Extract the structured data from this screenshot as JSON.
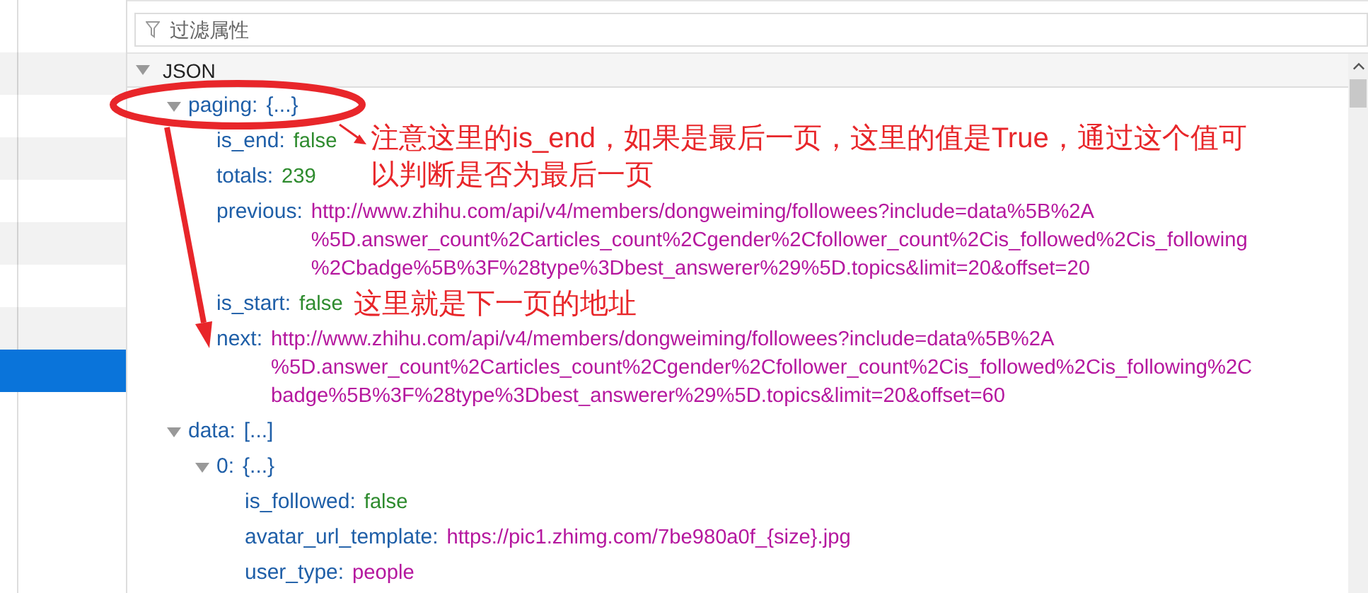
{
  "sidebar": {
    "rows": [
      {
        "selected": false
      },
      {
        "selected": false
      },
      {
        "selected": false
      },
      {
        "selected": false
      },
      {
        "selected": false
      },
      {
        "selected": false
      },
      {
        "selected": false
      },
      {
        "selected": false
      },
      {
        "selected": true
      }
    ]
  },
  "filter": {
    "placeholder": "过滤属性"
  },
  "tree": {
    "label": "JSON",
    "expanded": true,
    "children": [
      {
        "kind": "object",
        "key": "paging:",
        "summary": "{...}",
        "expanded": true,
        "children": [
          {
            "kind": "bool",
            "key": "is_end:",
            "lines": [
              "false"
            ]
          },
          {
            "kind": "number",
            "key": "totals:",
            "lines": [
              "239"
            ]
          },
          {
            "kind": "string",
            "key": "previous:",
            "lines": [
              "http://www.zhihu.com/api/v4/members/dongweiming/followees?include=data%5B%2A",
              "%5D.answer_count%2Carticles_count%2Cgender%2Cfollower_count%2Cis_followed%2Cis_following",
              "%2Cbadge%5B%3F%28type%3Dbest_answerer%29%5D.topics&limit=20&offset=20"
            ]
          },
          {
            "kind": "bool",
            "key": "is_start:",
            "lines": [
              "false"
            ]
          },
          {
            "kind": "string",
            "key": "next:",
            "lines": [
              "http://www.zhihu.com/api/v4/members/dongweiming/followees?include=data%5B%2A",
              "%5D.answer_count%2Carticles_count%2Cgender%2Cfollower_count%2Cis_followed%2Cis_following%2C",
              "badge%5B%3F%28type%3Dbest_answerer%29%5D.topics&limit=20&offset=60"
            ]
          }
        ]
      },
      {
        "kind": "object",
        "key": "data:",
        "summary": "[...]",
        "expanded": true,
        "children": [
          {
            "kind": "object",
            "key": "0:",
            "summary": "{...}",
            "expanded": true,
            "children": [
              {
                "kind": "bool",
                "key": "is_followed:",
                "lines": [
                  "false"
                ]
              },
              {
                "kind": "string",
                "key": "avatar_url_template:",
                "lines": [
                  "https://pic1.zhimg.com/7be980a0f_{size}.jpg"
                ]
              },
              {
                "kind": "string",
                "key": "user_type:",
                "lines": [
                  "people"
                ]
              }
            ]
          }
        ]
      }
    ]
  },
  "annotations": [
    {
      "kind": "note",
      "lines": [
        "注意这里的is_end，如果是最后一页，这里的值是True，通过这个值可",
        "以判断是否为最后一页"
      ]
    },
    {
      "kind": "note2",
      "lines": [
        "这里就是下一页的地址"
      ]
    }
  ]
}
